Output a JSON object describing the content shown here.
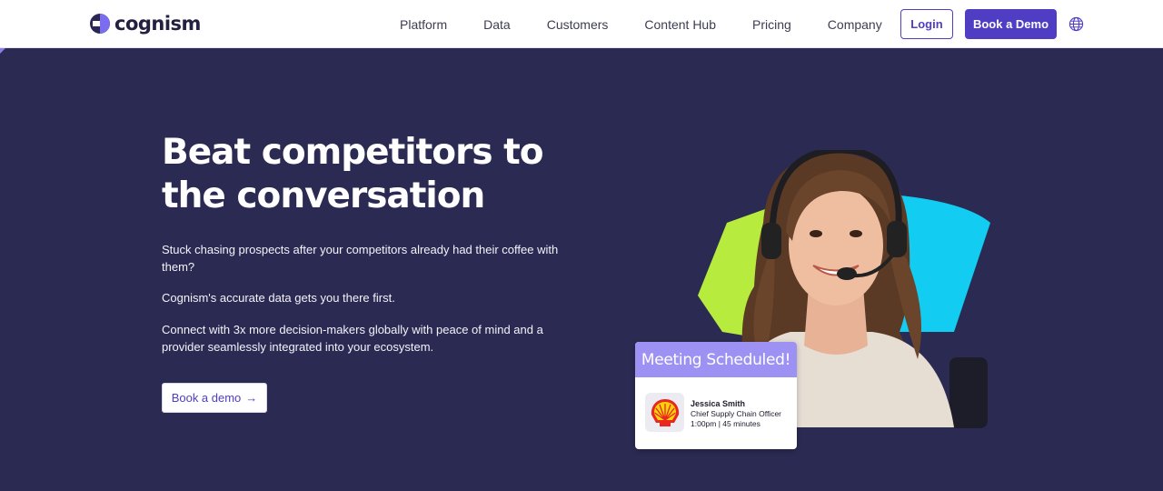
{
  "header": {
    "brand": "cognism",
    "nav": [
      "Platform",
      "Data",
      "Customers",
      "Content Hub",
      "Pricing",
      "Company"
    ],
    "login_label": "Login",
    "demo_label": "Book a Demo",
    "globe_icon": "globe-icon"
  },
  "hero": {
    "title_line1": "Beat competitors to",
    "title_line2": "the conversation",
    "paragraph1": "Stuck chasing prospects after your competitors already had their coffee with them?",
    "paragraph2": "Cognism's accurate data gets you there first.",
    "paragraph3": "Connect with 3x more decision-makers globally with peace of mind and a provider seamlessly integrated into your ecosystem.",
    "cta_label": "Book a demo",
    "cta_icon": "arrow-right-icon"
  },
  "card": {
    "heading": "Meeting Scheduled!",
    "name": "Jessica Smith",
    "role": "Chief Supply Chain Officer",
    "time": "1:00pm | 45 minutes",
    "logo_icon": "shell-logo-icon"
  },
  "colors": {
    "brand_purple": "#4f3ec4",
    "hero_bg": "#2b2a52",
    "accent_cyan": "#13ccf2",
    "accent_lime": "#b7ec3f",
    "card_header": "#9d92f4"
  }
}
